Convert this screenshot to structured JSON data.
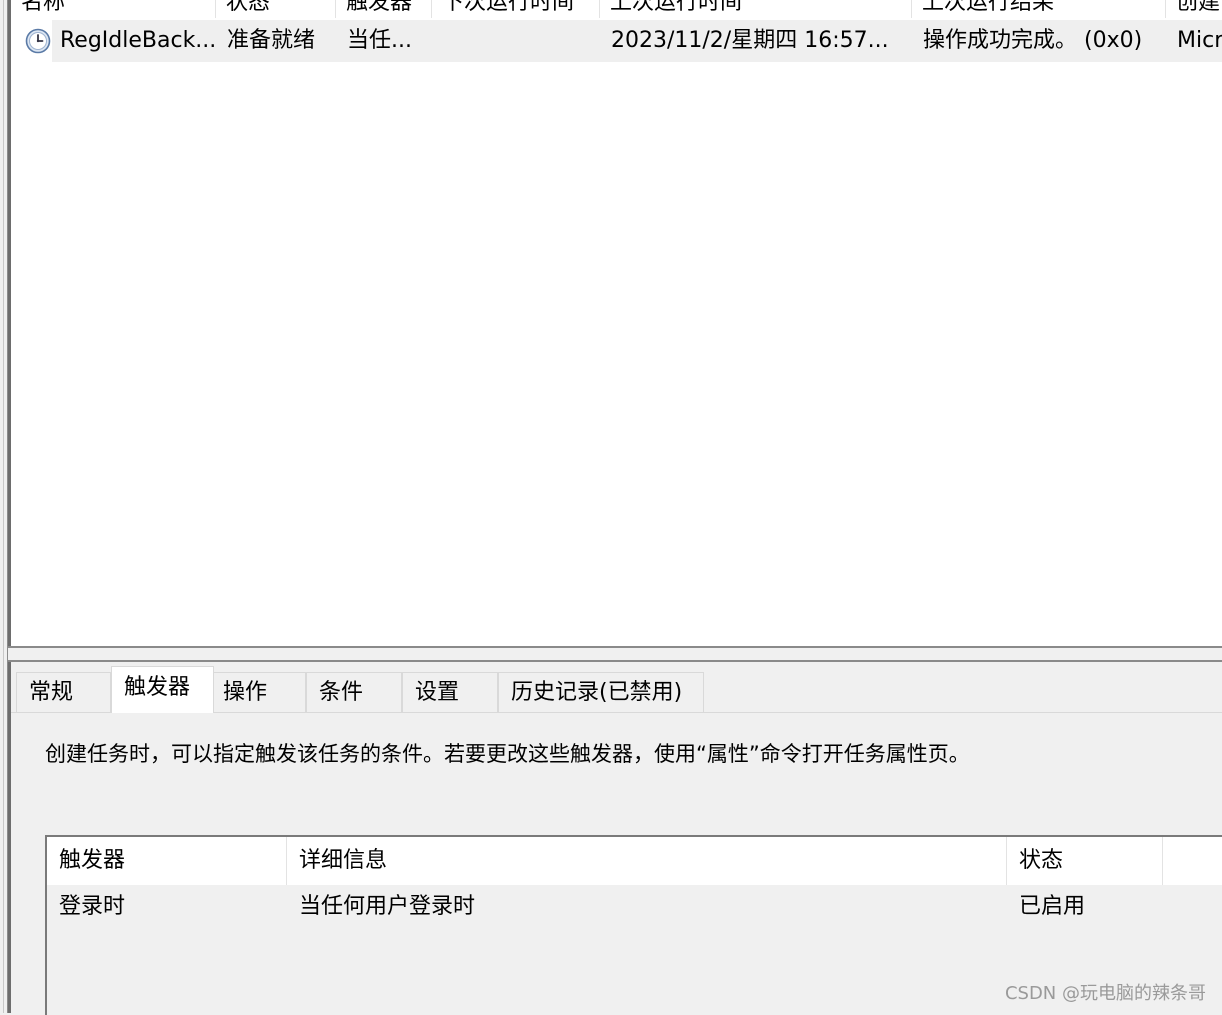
{
  "task_list": {
    "columns": [
      "名称",
      "状态",
      "触发器",
      "下次运行时间",
      "上次运行时间",
      "上次运行结果",
      "创建"
    ],
    "rows": [
      {
        "icon": "clock-icon",
        "name": "RegIdleBack...",
        "status": "准备就绪",
        "trigger": "当任...",
        "next_run": "",
        "last_run": "2023/11/2/星期四 16:57...",
        "last_result": "操作成功完成。 (0x0)",
        "author": "Micr"
      }
    ]
  },
  "tabs": [
    {
      "label": "常规",
      "active": false
    },
    {
      "label": "触发器",
      "active": true
    },
    {
      "label": "操作",
      "active": false
    },
    {
      "label": "条件",
      "active": false
    },
    {
      "label": "设置",
      "active": false
    },
    {
      "label": "历史记录(已禁用)",
      "active": false
    }
  ],
  "trigger_tab": {
    "description": "创建任务时，可以指定触发该任务的条件。若要更改这些触发器，使用“属性”命令打开任务属性页。",
    "table": {
      "columns": [
        "触发器",
        "详细信息",
        "状态"
      ],
      "rows": [
        {
          "trigger": "登录时",
          "details": "当任何用户登录时",
          "status": "已启用"
        }
      ]
    }
  },
  "watermark": "CSDN @玩电脑的辣条哥"
}
